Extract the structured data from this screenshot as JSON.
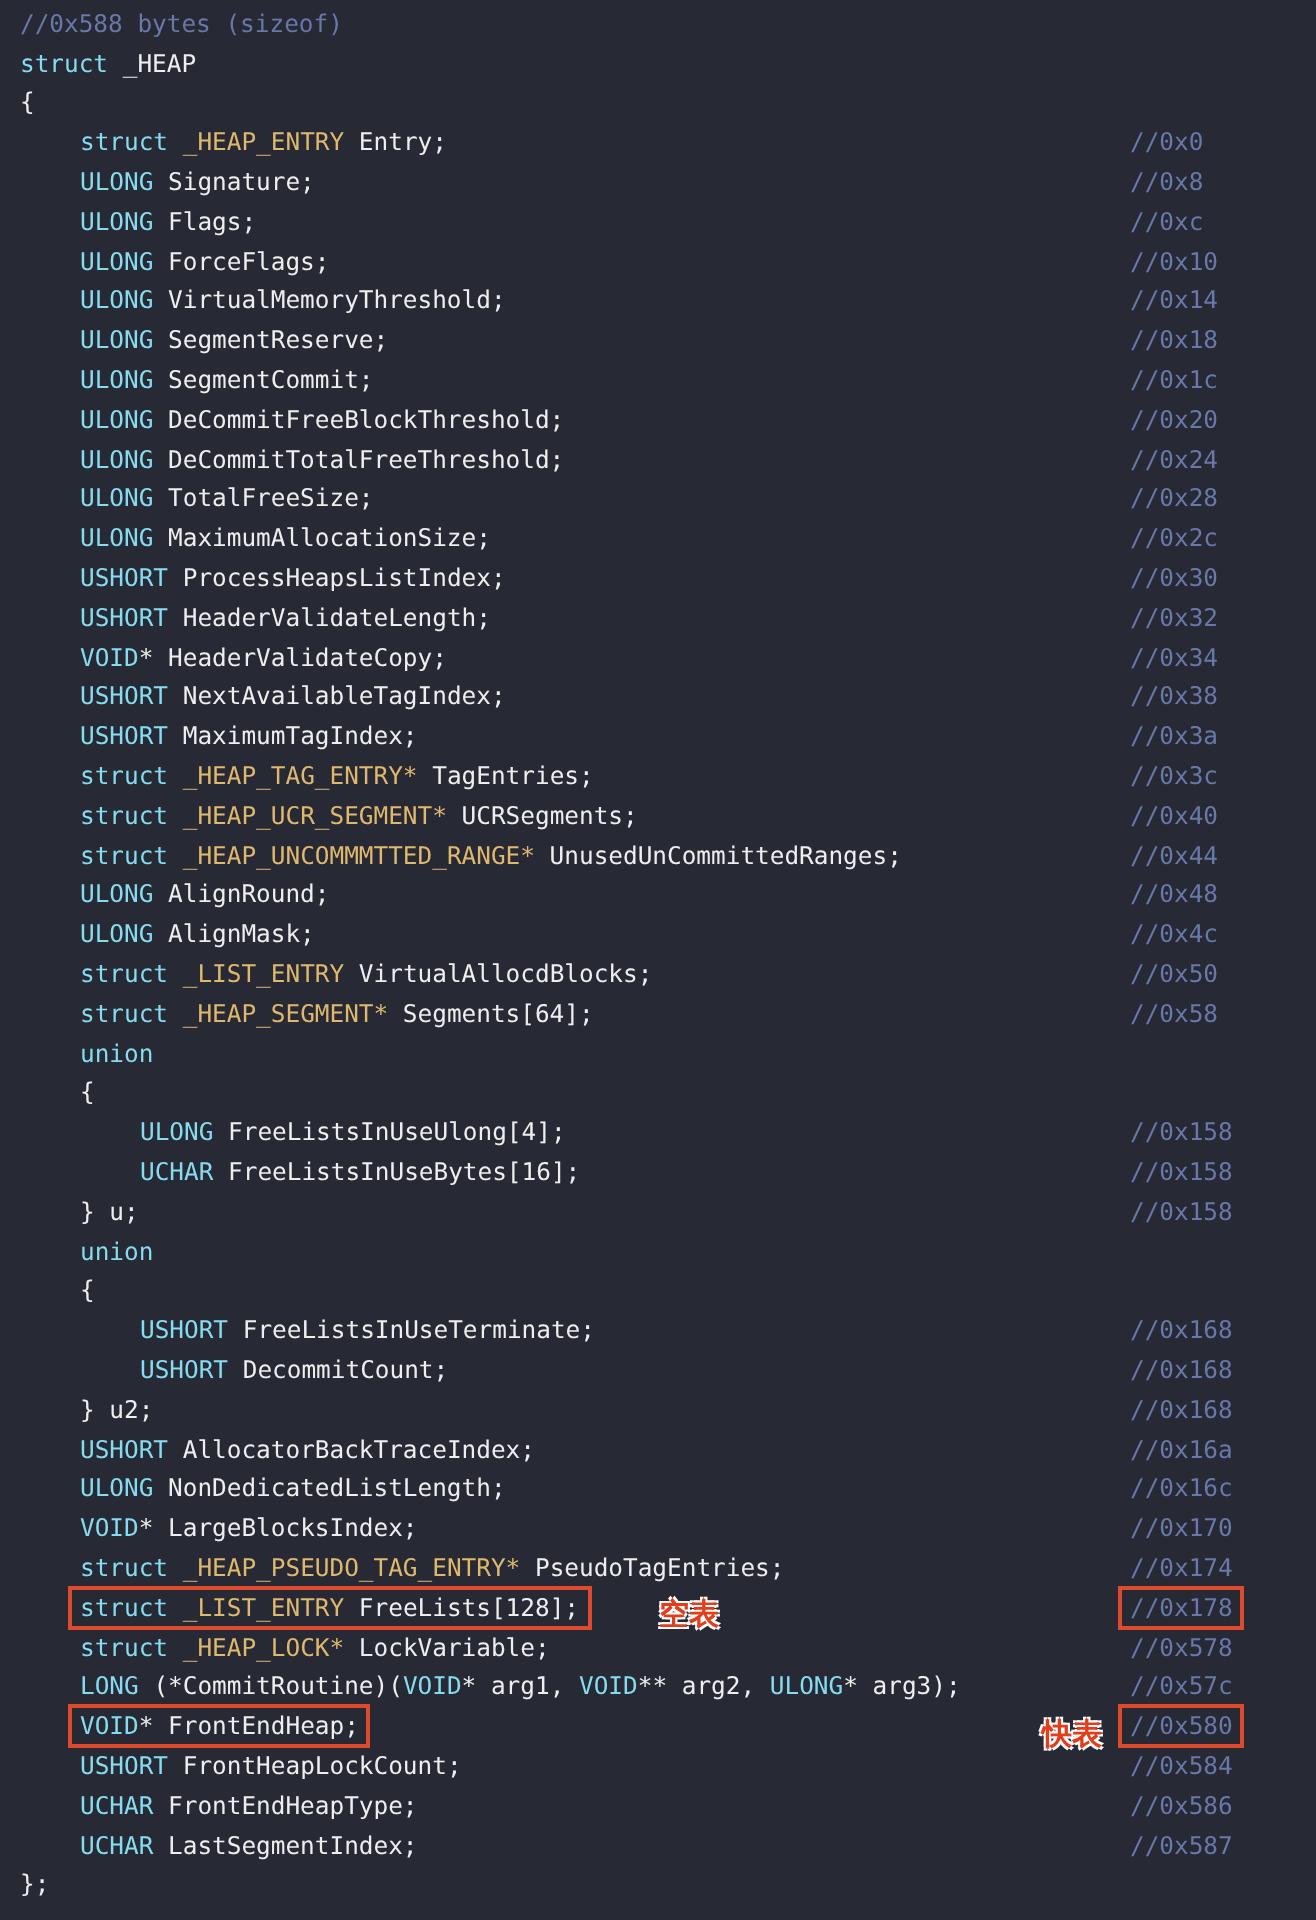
{
  "header_comment": "//0x588 bytes (sizeof)",
  "code": [
    {
      "tokens": [
        {
          "kind": "keyword",
          "text": "struct"
        },
        {
          "kind": "plain",
          "text": " _HEAP"
        }
      ],
      "highlighted": false
    },
    {
      "tokens": [
        {
          "kind": "plain",
          "text": "{"
        }
      ],
      "highlighted": false,
      "children": [
        {
          "tokens": [
            {
              "kind": "keyword",
              "text": "struct"
            },
            {
              "kind": "type",
              "text": " _HEAP_ENTRY"
            },
            {
              "kind": "plain",
              "text": " Entry;"
            }
          ],
          "offset": "//0x0",
          "highlighted": false
        },
        {
          "tokens": [
            {
              "kind": "keyword",
              "text": "ULONG"
            },
            {
              "kind": "plain",
              "text": " Signature;"
            }
          ],
          "offset": "//0x8",
          "highlighted": false
        },
        {
          "tokens": [
            {
              "kind": "keyword",
              "text": "ULONG"
            },
            {
              "kind": "plain",
              "text": " Flags;"
            }
          ],
          "offset": "//0xc",
          "highlighted": false
        },
        {
          "tokens": [
            {
              "kind": "keyword",
              "text": "ULONG"
            },
            {
              "kind": "plain",
              "text": " ForceFlags;"
            }
          ],
          "offset": "//0x10",
          "highlighted": false
        },
        {
          "tokens": [
            {
              "kind": "keyword",
              "text": "ULONG"
            },
            {
              "kind": "plain",
              "text": " VirtualMemoryThreshold;"
            }
          ],
          "offset": "//0x14",
          "highlighted": false
        },
        {
          "tokens": [
            {
              "kind": "keyword",
              "text": "ULONG"
            },
            {
              "kind": "plain",
              "text": " SegmentReserve;"
            }
          ],
          "offset": "//0x18",
          "highlighted": false
        },
        {
          "tokens": [
            {
              "kind": "keyword",
              "text": "ULONG"
            },
            {
              "kind": "plain",
              "text": " SegmentCommit;"
            }
          ],
          "offset": "//0x1c",
          "highlighted": false
        },
        {
          "tokens": [
            {
              "kind": "keyword",
              "text": "ULONG"
            },
            {
              "kind": "plain",
              "text": " DeCommitFreeBlockThreshold;"
            }
          ],
          "offset": "//0x20",
          "highlighted": false
        },
        {
          "tokens": [
            {
              "kind": "keyword",
              "text": "ULONG"
            },
            {
              "kind": "plain",
              "text": " DeCommitTotalFreeThreshold;"
            }
          ],
          "offset": "//0x24",
          "highlighted": false
        },
        {
          "tokens": [
            {
              "kind": "keyword",
              "text": "ULONG"
            },
            {
              "kind": "plain",
              "text": " TotalFreeSize;"
            }
          ],
          "offset": "//0x28",
          "highlighted": false
        },
        {
          "tokens": [
            {
              "kind": "keyword",
              "text": "ULONG"
            },
            {
              "kind": "plain",
              "text": " MaximumAllocationSize;"
            }
          ],
          "offset": "//0x2c",
          "highlighted": false
        },
        {
          "tokens": [
            {
              "kind": "keyword",
              "text": "USHORT"
            },
            {
              "kind": "plain",
              "text": " ProcessHeapsListIndex;"
            }
          ],
          "offset": "//0x30",
          "highlighted": false
        },
        {
          "tokens": [
            {
              "kind": "keyword",
              "text": "USHORT"
            },
            {
              "kind": "plain",
              "text": " HeaderValidateLength;"
            }
          ],
          "offset": "//0x32",
          "highlighted": false
        },
        {
          "tokens": [
            {
              "kind": "keyword",
              "text": "VOID"
            },
            {
              "kind": "plain",
              "text": "* HeaderValidateCopy;"
            }
          ],
          "offset": "//0x34",
          "highlighted": false
        },
        {
          "tokens": [
            {
              "kind": "keyword",
              "text": "USHORT"
            },
            {
              "kind": "plain",
              "text": " NextAvailableTagIndex;"
            }
          ],
          "offset": "//0x38",
          "highlighted": false
        },
        {
          "tokens": [
            {
              "kind": "keyword",
              "text": "USHORT"
            },
            {
              "kind": "plain",
              "text": " MaximumTagIndex;"
            }
          ],
          "offset": "//0x3a",
          "highlighted": false
        },
        {
          "tokens": [
            {
              "kind": "keyword",
              "text": "struct"
            },
            {
              "kind": "type",
              "text": " _HEAP_TAG_ENTRY*"
            },
            {
              "kind": "plain",
              "text": " TagEntries;"
            }
          ],
          "offset": "//0x3c",
          "highlighted": false
        },
        {
          "tokens": [
            {
              "kind": "keyword",
              "text": "struct"
            },
            {
              "kind": "type",
              "text": " _HEAP_UCR_SEGMENT*"
            },
            {
              "kind": "plain",
              "text": " UCRSegments;"
            }
          ],
          "offset": "//0x40",
          "highlighted": false
        },
        {
          "tokens": [
            {
              "kind": "keyword",
              "text": "struct"
            },
            {
              "kind": "type",
              "text": " _HEAP_UNCOMMMTTED_RANGE*"
            },
            {
              "kind": "plain",
              "text": " UnusedUnCommittedRanges;"
            }
          ],
          "offset": "//0x44",
          "highlighted": false
        },
        {
          "tokens": [
            {
              "kind": "keyword",
              "text": "ULONG"
            },
            {
              "kind": "plain",
              "text": " AlignRound;"
            }
          ],
          "offset": "//0x48",
          "highlighted": false
        },
        {
          "tokens": [
            {
              "kind": "keyword",
              "text": "ULONG"
            },
            {
              "kind": "plain",
              "text": " AlignMask;"
            }
          ],
          "offset": "//0x4c",
          "highlighted": false
        },
        {
          "tokens": [
            {
              "kind": "keyword",
              "text": "struct"
            },
            {
              "kind": "type",
              "text": " _LIST_ENTRY"
            },
            {
              "kind": "plain",
              "text": " VirtualAllocdBlocks;"
            }
          ],
          "offset": "//0x50",
          "highlighted": false
        },
        {
          "tokens": [
            {
              "kind": "keyword",
              "text": "struct"
            },
            {
              "kind": "type",
              "text": " _HEAP_SEGMENT*"
            },
            {
              "kind": "plain",
              "text": " Segments[64];"
            }
          ],
          "offset": "//0x58",
          "highlighted": false
        },
        {
          "tokens": [
            {
              "kind": "keyword",
              "text": "union"
            }
          ],
          "highlighted": false
        },
        {
          "tokens": [
            {
              "kind": "plain",
              "text": "{"
            }
          ],
          "highlighted": false,
          "children": [
            {
              "tokens": [
                {
                  "kind": "keyword",
                  "text": "ULONG"
                },
                {
                  "kind": "plain",
                  "text": " FreeListsInUseUlong[4];"
                }
              ],
              "offset": "//0x158",
              "highlighted": false
            },
            {
              "tokens": [
                {
                  "kind": "keyword",
                  "text": "UCHAR"
                },
                {
                  "kind": "plain",
                  "text": " FreeListsInUseBytes[16];"
                }
              ],
              "offset": "//0x158",
              "highlighted": false
            }
          ]
        },
        {
          "tokens": [
            {
              "kind": "plain",
              "text": "} u;"
            }
          ],
          "offset": "//0x158",
          "highlighted": false
        },
        {
          "tokens": [
            {
              "kind": "keyword",
              "text": "union"
            }
          ],
          "highlighted": false
        },
        {
          "tokens": [
            {
              "kind": "plain",
              "text": "{"
            }
          ],
          "highlighted": false,
          "children": [
            {
              "tokens": [
                {
                  "kind": "keyword",
                  "text": "USHORT"
                },
                {
                  "kind": "plain",
                  "text": " FreeListsInUseTerminate;"
                }
              ],
              "offset": "//0x168",
              "highlighted": false
            },
            {
              "tokens": [
                {
                  "kind": "keyword",
                  "text": "USHORT"
                },
                {
                  "kind": "plain",
                  "text": " DecommitCount;"
                }
              ],
              "offset": "//0x168",
              "highlighted": false
            }
          ]
        },
        {
          "tokens": [
            {
              "kind": "plain",
              "text": "} u2;"
            }
          ],
          "offset": "//0x168",
          "highlighted": false
        },
        {
          "tokens": [
            {
              "kind": "keyword",
              "text": "USHORT"
            },
            {
              "kind": "plain",
              "text": " AllocatorBackTraceIndex;"
            }
          ],
          "offset": "//0x16a",
          "highlighted": false
        },
        {
          "tokens": [
            {
              "kind": "keyword",
              "text": "ULONG"
            },
            {
              "kind": "plain",
              "text": " NonDedicatedListLength;"
            }
          ],
          "offset": "//0x16c",
          "highlighted": false
        },
        {
          "tokens": [
            {
              "kind": "keyword",
              "text": "VOID"
            },
            {
              "kind": "plain",
              "text": "* LargeBlocksIndex;"
            }
          ],
          "offset": "//0x170",
          "highlighted": false
        },
        {
          "tokens": [
            {
              "kind": "keyword",
              "text": "struct"
            },
            {
              "kind": "type",
              "text": " _HEAP_PSEUDO_TAG_ENTRY*"
            },
            {
              "kind": "plain",
              "text": " PseudoTagEntries;"
            }
          ],
          "offset": "//0x174",
          "highlighted": false
        },
        {
          "tokens": [
            {
              "kind": "keyword",
              "text": "struct"
            },
            {
              "kind": "type",
              "text": " _LIST_ENTRY"
            },
            {
              "kind": "plain",
              "text": " FreeLists[128];"
            }
          ],
          "offset": "//0x178",
          "highlighted": true,
          "note": {
            "text": "空表",
            "kind": "inline"
          }
        },
        {
          "tokens": [
            {
              "kind": "keyword",
              "text": "struct"
            },
            {
              "kind": "type",
              "text": " _HEAP_LOCK*"
            },
            {
              "kind": "plain",
              "text": " LockVariable;"
            }
          ],
          "offset": "//0x578",
          "highlighted": false
        },
        {
          "tokens": [
            {
              "kind": "keyword",
              "text": "LONG"
            },
            {
              "kind": "plain",
              "text": " (*CommitRoutine)("
            },
            {
              "kind": "keyword",
              "text": "VOID"
            },
            {
              "kind": "plain",
              "text": "* arg1, "
            },
            {
              "kind": "keyword",
              "text": "VOID"
            },
            {
              "kind": "plain",
              "text": "** arg2, "
            },
            {
              "kind": "keyword",
              "text": "ULONG"
            },
            {
              "kind": "plain",
              "text": "* arg3);"
            }
          ],
          "offset": "//0x57c",
          "highlighted": false
        },
        {
          "tokens": [
            {
              "kind": "keyword",
              "text": "VOID"
            },
            {
              "kind": "plain",
              "text": "* FrontEndHeap;"
            }
          ],
          "offset": "//0x580",
          "highlighted": true,
          "note": {
            "text": "快表",
            "kind": "aside"
          }
        },
        {
          "tokens": [
            {
              "kind": "keyword",
              "text": "USHORT"
            },
            {
              "kind": "plain",
              "text": " FrontHeapLockCount;"
            }
          ],
          "offset": "//0x584",
          "highlighted": false
        },
        {
          "tokens": [
            {
              "kind": "keyword",
              "text": "UCHAR"
            },
            {
              "kind": "plain",
              "text": " FrontEndHeapType;"
            }
          ],
          "offset": "//0x586",
          "highlighted": false
        },
        {
          "tokens": [
            {
              "kind": "keyword",
              "text": "UCHAR"
            },
            {
              "kind": "plain",
              "text": " LastSegmentIndex;"
            }
          ],
          "offset": "//0x587",
          "highlighted": false
        }
      ]
    },
    {
      "tokens": [
        {
          "kind": "plain",
          "text": "};"
        }
      ],
      "highlighted": false
    }
  ]
}
